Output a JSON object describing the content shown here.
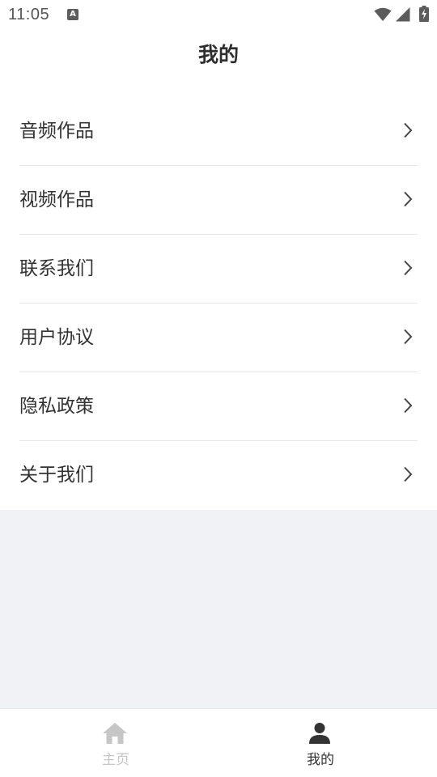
{
  "status_bar": {
    "time": "11:05",
    "notification_glyph": "A",
    "icons": [
      "a-notification-icon",
      "wifi-icon",
      "signal-icon",
      "battery-charging-icon"
    ]
  },
  "header": {
    "title": "我的"
  },
  "menu": {
    "items": [
      {
        "label": "音频作品",
        "icon": "chevron-right-icon"
      },
      {
        "label": "视频作品",
        "icon": "chevron-right-icon"
      },
      {
        "label": "联系我们",
        "icon": "chevron-right-icon"
      },
      {
        "label": "用户协议",
        "icon": "chevron-right-icon"
      },
      {
        "label": "隐私政策",
        "icon": "chevron-right-icon"
      },
      {
        "label": "关于我们",
        "icon": "chevron-right-icon"
      }
    ]
  },
  "tab_bar": {
    "tabs": [
      {
        "label": "主页",
        "icon": "home-icon",
        "active": false
      },
      {
        "label": "我的",
        "icon": "person-icon",
        "active": true
      }
    ],
    "active_color": "#333333",
    "inactive_color": "#c6c6c6"
  },
  "colors": {
    "background": "#f1f2f6",
    "surface": "#ffffff",
    "text": "#333333",
    "divider": "#e6e6e6"
  }
}
